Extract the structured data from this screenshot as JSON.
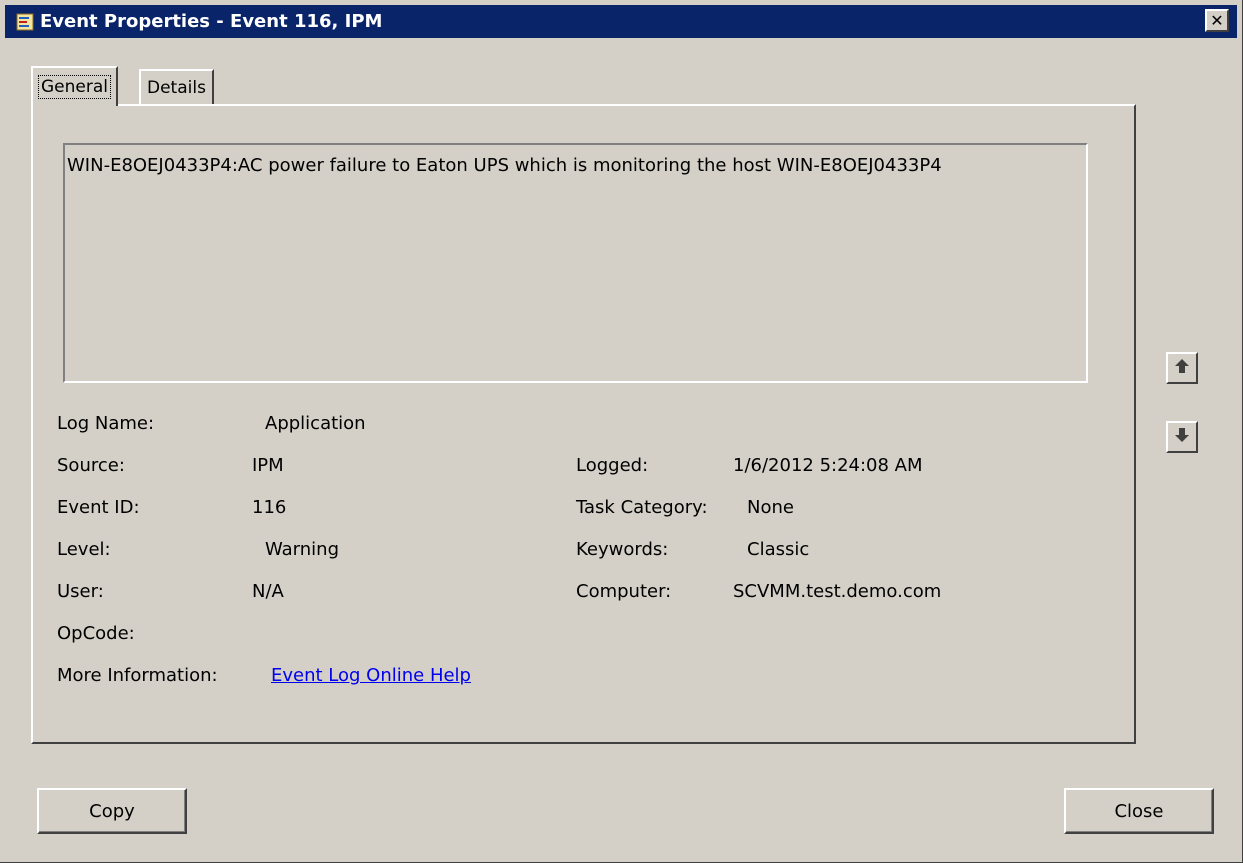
{
  "window": {
    "title": "Event Properties - Event 116, IPM",
    "close_glyph": "✕"
  },
  "tabs": [
    {
      "label": "General",
      "active": true
    },
    {
      "label": "Details",
      "active": false
    }
  ],
  "message": "WIN-E8OEJ0433P4:AC power failure to Eaton UPS which is monitoring the host WIN-E8OEJ0433P4",
  "fields": {
    "log_name": {
      "label": "Log Name:",
      "value": "Application"
    },
    "source": {
      "label": "Source:",
      "value": "IPM"
    },
    "event_id": {
      "label": "Event ID:",
      "value": "116"
    },
    "level": {
      "label": "Level:",
      "value": "Warning"
    },
    "user": {
      "label": "User:",
      "value": "N/A"
    },
    "opcode": {
      "label": "OpCode:",
      "value": ""
    },
    "more_info": {
      "label": "More Information:",
      "value": "Event Log Online Help"
    },
    "logged": {
      "label": "Logged:",
      "value": "1/6/2012 5:24:08 AM"
    },
    "task_category": {
      "label": "Task Category:",
      "value": "None"
    },
    "keywords": {
      "label": "Keywords:",
      "value": "Classic"
    },
    "computer": {
      "label": "Computer:",
      "value": "SCVMM.test.demo.com"
    }
  },
  "buttons": {
    "copy": "Copy",
    "close": "Close"
  },
  "icons": {
    "title": "event-viewer-icon",
    "up": "arrow-up-icon",
    "down": "arrow-down-icon"
  }
}
